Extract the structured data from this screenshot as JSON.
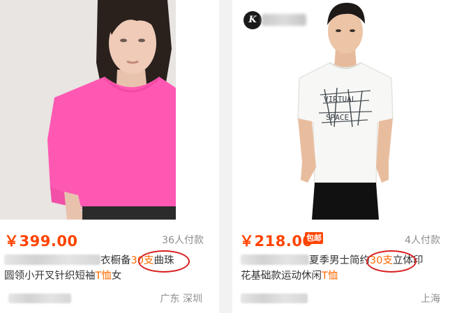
{
  "products": [
    {
      "price": "￥399.00",
      "sold": "36人付款",
      "title_line1_a": "衣橱",
      "title_line1_b": "备",
      "title_line1_hl": "30支",
      "title_line1_c": "曲珠",
      "title_line2_a": "圆领小开叉针织短袖",
      "title_line2_hl": "T恤",
      "title_line2_b": "女",
      "location": "广东 深圳"
    },
    {
      "price": "￥218.00",
      "badge": "包邮",
      "sold": "4人付款",
      "title_line1_a": "夏季男士简约",
      "title_line1_hl": "30支",
      "title_line1_c": "立体印",
      "title_line2_a": "花基础款运动休闲",
      "title_line2_hl": "T恤",
      "location": "上海",
      "shop_logo_letter": "K",
      "tshirt_print_line1": "VIRTUAL",
      "tshirt_print_line2": "SPACE"
    }
  ],
  "colors": {
    "price": "#ff4400",
    "highlight": "#ff6a00",
    "annotation_circle": "#d81e1e",
    "pink_shirt": "#ff58b3"
  }
}
